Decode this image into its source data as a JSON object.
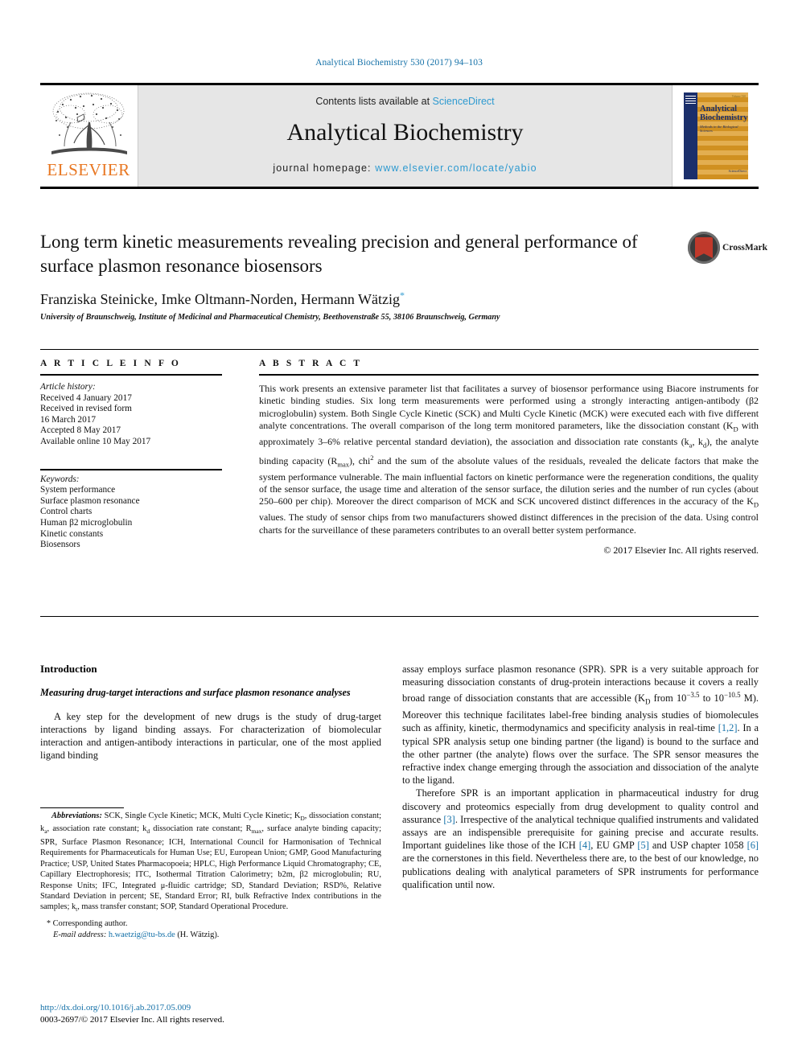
{
  "running_head": "Analytical Biochemistry 530 (2017) 94–103",
  "masthead": {
    "contents_prefix": "Contents lists available at ",
    "sciencedirect": "ScienceDirect",
    "journal_name": "Analytical Biochemistry",
    "homepage_prefix": "journal homepage: ",
    "homepage_url": "www.elsevier.com/locate/yabio",
    "publisher": "ELSEVIER",
    "cover": {
      "title_line1": "Analytical",
      "title_line2": "Biochemistry",
      "subtitle": "Methods in the Biological Sciences",
      "footer": "ScienceDirect",
      "topright": "Volume 530"
    },
    "accent_blue": "#2e9ad0",
    "elsevier_orange": "#e87722"
  },
  "title_block": {
    "title": "Long term kinetic measurements revealing precision and general performance of surface plasmon resonance biosensors",
    "authors": "Franziska Steinicke, Imke Oltmann-Norden, Hermann Wätzig",
    "corresponding_marker": "*",
    "affiliation": "University of Braunschweig, Institute of Medicinal and Pharmaceutical Chemistry, Beethovenstraße 55, 38106 Braunschweig, Germany",
    "crossmark_label": "CrossMark"
  },
  "article_info": {
    "heading": "A R T I C L E   I N F O",
    "history_label": "Article history:",
    "history": [
      "Received 4 January 2017",
      "Received in revised form",
      "16 March 2017",
      "Accepted 8 May 2017",
      "Available online 10 May 2017"
    ],
    "keywords_label": "Keywords:",
    "keywords": [
      "System performance",
      "Surface plasmon resonance",
      "Control charts",
      "Human β2 microglobulin",
      "Kinetic constants",
      "Biosensors"
    ]
  },
  "abstract": {
    "heading": "A B S T R A C T",
    "part1": "This work presents an extensive parameter list that facilitates a survey of biosensor performance using Biacore instruments for kinetic binding studies. Six long term measurements were performed using a strongly interacting antigen-antibody (β2 microglobulin) system. Both Single Cycle Kinetic (SCK) and Multi Cycle Kinetic (MCK) were executed each with five different analyte concentrations. The overall comparison of the long term monitored parameters, like the dissociation constant (K",
    "sub1": "D",
    "part2": " with approximately 3–6% relative percental standard deviation), the association and dissociation rate constants (k",
    "sub2": "a",
    "part3": ", k",
    "sub3": "d",
    "part4": "), the analyte binding capacity (R",
    "sub4": "max",
    "part5": "), chi",
    "sup5": "2",
    "part6": " and the sum of the absolute values of the residuals, revealed the delicate factors that make the system performance vulnerable. The main influential factors on kinetic performance were the regeneration conditions, the quality of the sensor surface, the usage time and alteration of the sensor surface, the dilution series and the number of run cycles (about 250–600 per chip). Moreover the direct comparison of MCK and SCK uncovered distinct differences in the accuracy of the K",
    "sub6": "D",
    "part7": " values. The study of sensor chips from two manufacturers showed distinct differences in the precision of the data. Using control charts for the surveillance of these parameters contributes to an overall better system performance.",
    "copyright": "© 2017 Elsevier Inc. All rights reserved."
  },
  "body": {
    "intro_heading": "Introduction",
    "intro_subheading": "Measuring drug-target interactions and surface plasmon resonance analyses",
    "left_para1": "A key step for the development of new drugs is the study of drug-target interactions by ligand binding assays. For characterization of biomolecular interaction and antigen-antibody interactions in particular, one of the most applied ligand binding",
    "right_para1_a": "assay employs surface plasmon resonance (SPR). SPR is a very suitable approach for measuring dissociation constants of drug-protein interactions because it covers a really broad range of dissociation constants that are accessible (K",
    "right_para1_sub": "D",
    "right_para1_b": " from 10",
    "right_para1_sup1": "−3.5",
    "right_para1_c": " to 10",
    "right_para1_sup2": "−10.5",
    "right_para1_d": " M). Moreover this technique facilitates label-free binding analysis studies of biomolecules such as affinity, kinetic, thermodynamics and specificity analysis in real-time ",
    "ref_12": "[1,2]",
    "right_para1_e": ". In a typical SPR analysis setup one binding partner (the ligand) is bound to the surface and the other partner (the analyte) flows over the surface. The SPR sensor measures the refractive index change emerging through the association and dissociation of the analyte to the ligand.",
    "right_para2_a": "Therefore SPR is an important application in pharmaceutical industry for drug discovery and proteomics especially from drug development to quality control and assurance ",
    "ref_3": "[3]",
    "right_para2_b": ". Irrespective of the analytical technique qualified instruments and validated assays are an indispensible prerequisite for gaining precise and accurate results. Important guidelines like those of the ICH ",
    "ref_4": "[4]",
    "right_para2_c": ", EU GMP ",
    "ref_5": "[5]",
    "right_para2_d": " and USP chapter 1058 ",
    "ref_6": "[6]",
    "right_para2_e": " are the cornerstones in this field. Nevertheless there are, to the best of our knowledge, no publications dealing with analytical parameters of SPR instruments for performance qualification until now."
  },
  "footnotes": {
    "abbreviations_label": "Abbreviations:",
    "abbreviations_a": " SCK, Single Cycle Kinetic; MCK, Multi Cycle Kinetic; K",
    "abbr_sub1": "D",
    "abbreviations_b": ", dissociation constant; k",
    "abbr_sub2": "a",
    "abbreviations_c": ", association rate constant; k",
    "abbr_sub3": "d",
    "abbreviations_d": " dissociation rate constant; R",
    "abbr_sub4": "max",
    "abbreviations_e": ", surface analyte binding capacity; SPR, Surface Plasmon Resonance; ICH, International Council for Harmonisation of Technical Requirements for Pharmaceuticals for Human Use; EU, European Union; GMP, Good Manufacturing Practice; USP, United States Pharmacopoeia; HPLC, High Performance Liquid Chromatography; CE, Capillary Electrophoresis; ITC, Isothermal Titration Calorimetry; b2m, β2 microglobulin; RU, Response Units; IFC, Integrated μ-fluidic cartridge; SD, Standard Deviation; RSD%, Relative Standard Deviation in percent; SE, Standard Error; RI, bulk Refractive Index contributions in the samples; k",
    "abbr_sub5": "t",
    "abbreviations_f": ", mass transfer constant; SOP, Standard Operational Procedure.",
    "corresponding_star": "*",
    "corresponding_text": " Corresponding author.",
    "email_label": "E-mail address:",
    "email_address": "h.waetzig@tu-bs.de",
    "email_suffix": " (H. Wätzig)."
  },
  "bottom_meta": {
    "doi": "http://dx.doi.org/10.1016/j.ab.2017.05.009",
    "issn_line": "0003-2697/© 2017 Elsevier Inc. All rights reserved."
  }
}
